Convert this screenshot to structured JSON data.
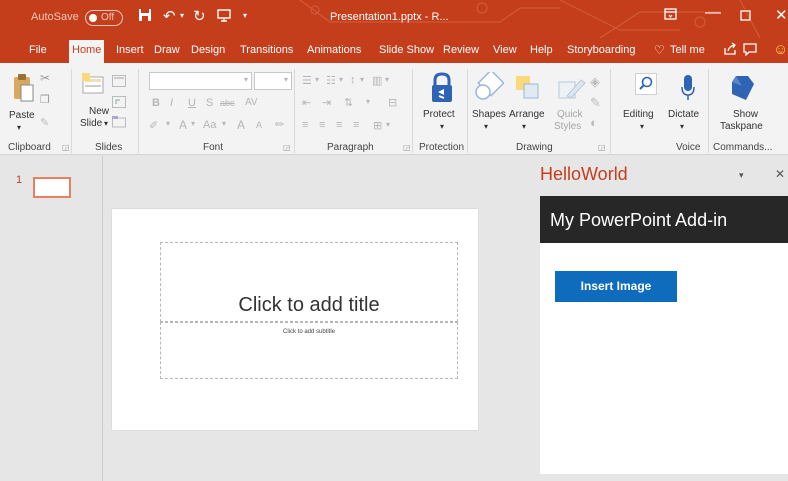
{
  "titlebar": {
    "autosave_label": "AutoSave",
    "autosave_state": "Off",
    "document_title": "Presentation1.pptx - R..."
  },
  "tabs": [
    "File",
    "Home",
    "Insert",
    "Draw",
    "Design",
    "Transitions",
    "Animations",
    "Slide Show",
    "Review",
    "View",
    "Help",
    "Storyboarding"
  ],
  "tell_me": "Tell me",
  "ribbon": {
    "clipboard": {
      "paste": "Paste",
      "group": "Clipboard"
    },
    "slides": {
      "new_slide_1": "New",
      "new_slide_2": "Slide",
      "group": "Slides"
    },
    "font": {
      "group": "Font"
    },
    "paragraph": {
      "group": "Paragraph"
    },
    "protection": {
      "protect": "Protect",
      "group": "Protection"
    },
    "drawing": {
      "shapes": "Shapes",
      "arrange": "Arrange",
      "quick_1": "Quick",
      "quick_2": "Styles",
      "group": "Drawing"
    },
    "editing": {
      "label": "Editing"
    },
    "voice": {
      "dictate": "Dictate",
      "group": "Voice"
    },
    "commands": {
      "show_1": "Show",
      "show_2": "Taskpane",
      "group": "Commands..."
    }
  },
  "thumbnails": {
    "slide_number": "1"
  },
  "slide": {
    "title_placeholder": "Click to add title",
    "subtitle_placeholder": "Click to add subtitle"
  },
  "taskpane": {
    "title": "HelloWorld",
    "header": "My PowerPoint Add-in",
    "insert_button": "Insert Image"
  },
  "colors": {
    "accent": "#c43e1c",
    "pane_header": "#272727",
    "button": "#0f6cbd"
  }
}
